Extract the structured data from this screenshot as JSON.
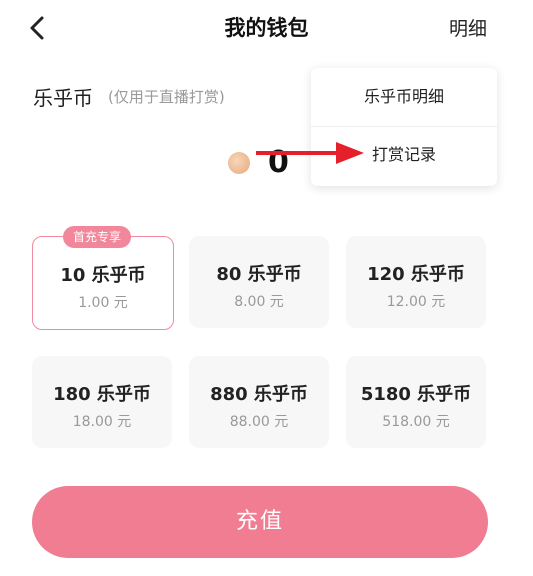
{
  "header": {
    "title": "我的钱包",
    "detail_label": "明细"
  },
  "wallet": {
    "coin_label": "乐乎币",
    "coin_note": "(仅用于直播打赏)",
    "balance": "0"
  },
  "menu": {
    "items": [
      {
        "label": "乐乎币明细"
      },
      {
        "label": "打赏记录"
      }
    ]
  },
  "arrow": {
    "color": "#e5202a"
  },
  "packages": {
    "badge": "首充专享",
    "items": [
      {
        "coins": "10 乐乎币",
        "price": "1.00 元",
        "selected": true
      },
      {
        "coins": "80 乐乎币",
        "price": "8.00 元"
      },
      {
        "coins": "120 乐乎币",
        "price": "12.00 元"
      },
      {
        "coins": "180 乐乎币",
        "price": "18.00 元"
      },
      {
        "coins": "880 乐乎币",
        "price": "88.00 元"
      },
      {
        "coins": "5180 乐乎币",
        "price": "518.00 元"
      }
    ]
  },
  "recharge": {
    "label": "充值",
    "color": "#f07d92"
  }
}
